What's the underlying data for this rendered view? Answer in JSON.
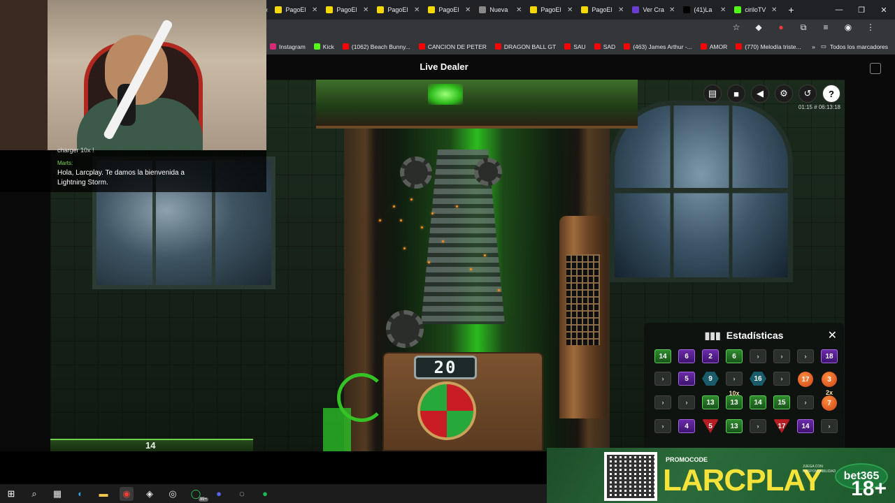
{
  "browser": {
    "tabs": [
      {
        "label": "PagoEl",
        "color": "#f5d800"
      },
      {
        "label": "PagoEl",
        "color": "#f5d800"
      },
      {
        "label": "PagoEl",
        "color": "#f5d800"
      },
      {
        "label": "PagoEl",
        "color": "#f5d800"
      },
      {
        "label": "Nueva",
        "color": "#888888"
      },
      {
        "label": "PagoEl",
        "color": "#f5d800"
      },
      {
        "label": "PagoEl",
        "color": "#f5d800"
      },
      {
        "label": "Ver Cra",
        "color": "#6a3ccf"
      },
      {
        "label": "(41)La",
        "color": "#000000"
      },
      {
        "label": "ciriloTV",
        "color": "#53fc18"
      }
    ],
    "bookmarks": [
      {
        "label": "Instagram",
        "color": "#d62976"
      },
      {
        "label": "Kick",
        "color": "#53fc18"
      },
      {
        "label": "(1062) Beach Bunny...",
        "color": "#ff0000"
      },
      {
        "label": "CANCION DE PETER",
        "color": "#ff0000"
      },
      {
        "label": "DRAGON BALL GT",
        "color": "#ff0000"
      },
      {
        "label": "SAU",
        "color": "#ff0000"
      },
      {
        "label": "SAD",
        "color": "#ff0000"
      },
      {
        "label": "(463) James Arthur -...",
        "color": "#ff0000"
      },
      {
        "label": "AMOR",
        "color": "#ff0000"
      },
      {
        "label": "(770) Melodía triste...",
        "color": "#ff0000"
      }
    ],
    "all_bookmarks": "Todos los marcadores"
  },
  "game": {
    "title": "Live Dealer",
    "time": "01:15",
    "round_id": "# 06:13:18",
    "counter": "20",
    "bottom_value": "14"
  },
  "stats": {
    "title": "Estadísticas",
    "rows": [
      [
        {
          "v": "14",
          "t": "green"
        },
        {
          "v": "6",
          "t": "purple"
        },
        {
          "v": "2",
          "t": "purple"
        },
        {
          "v": "6",
          "t": "green"
        },
        {
          "v": "›",
          "t": "arrow"
        },
        {
          "v": "›",
          "t": "arrow"
        },
        {
          "v": "›",
          "t": "arrow"
        },
        {
          "v": "18",
          "t": "purple"
        }
      ],
      [
        {
          "v": "›",
          "t": "arrow"
        },
        {
          "v": "5",
          "t": "purple"
        },
        {
          "v": "9",
          "t": "teal"
        },
        {
          "v": "›",
          "t": "arrow"
        },
        {
          "v": "16",
          "t": "teal"
        },
        {
          "v": "›",
          "t": "arrow"
        },
        {
          "v": "17",
          "t": "orange"
        },
        {
          "v": "3",
          "t": "orange"
        }
      ],
      [
        {
          "v": "›",
          "t": "arrow"
        },
        {
          "v": "›",
          "t": "arrow"
        },
        {
          "v": "13",
          "t": "green"
        },
        {
          "v": "13",
          "t": "green",
          "m": "10x"
        },
        {
          "v": "14",
          "t": "green"
        },
        {
          "v": "15",
          "t": "green"
        },
        {
          "v": "›",
          "t": "arrow"
        },
        {
          "v": "7",
          "t": "orange",
          "m": "2x"
        }
      ],
      [
        {
          "v": "›",
          "t": "arrow"
        },
        {
          "v": "4",
          "t": "purple"
        },
        {
          "v": "5",
          "t": "red",
          "m": "15x"
        },
        {
          "v": "13",
          "t": "green"
        },
        {
          "v": "›",
          "t": "arrow"
        },
        {
          "v": "17",
          "t": "red"
        },
        {
          "v": "14",
          "t": "purple"
        },
        {
          "v": "›",
          "t": "arrow"
        }
      ]
    ]
  },
  "chat": {
    "previous": "charger 10x !",
    "user": "Marts:",
    "message": "Hola, Larcplay. Te damos la bienvenida a Lightning Storm."
  },
  "promo": {
    "label": "PROMOCODE",
    "code": "LARCPLAY",
    "brand": "bet365",
    "age": "18+",
    "disclaimer": "JUEGA CON RESPONSABILIDAD"
  },
  "taskbar": {
    "badge": "99+"
  }
}
